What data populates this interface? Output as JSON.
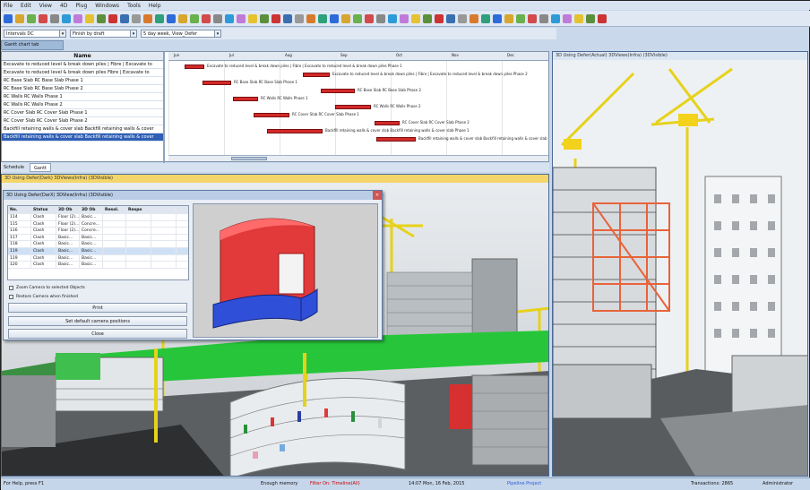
{
  "menu": [
    "File",
    "Edit",
    "View",
    "4D",
    "Plug",
    "Windows",
    "Tools",
    "Help"
  ],
  "toolbar2": {
    "combo1": "Intervals DC",
    "combo2": "Finish by draft",
    "combo3": "5 day week, View_Defer"
  },
  "subtab": "Gantt chart tab",
  "gantt": {
    "header": "Name",
    "rows": [
      "Excavate to reduced level & break down piles | Fibre | Excavate to",
      "Excavate to reduced level & break down piles Fibre | Excavate to",
      "RC Base Slab RC Base Slab Phase 1",
      "RC Base Slab RC Base Slab Phase 2",
      "RC Walls RC Walls Phase 1",
      "RC Walls RC Walls Phase 2",
      "RC Cover Slab RC Cover Slab Phase 1",
      "RC Cover Slab RC Cover Slab Phase 2",
      "Backfill retaining walls & cover slab Backfill retaining walls & cover",
      "Backfill retaining walls & cover slab Backfill retaining walls & cover"
    ],
    "bar_labels": [
      "Excavate to reduced level & break down piles | Fibre | Excavate to reduced level & break down piles Phase 1",
      "Excavate to reduced level & break down piles | Fibre | Excavate to reduced level & break down piles Phase 2",
      "RC Base Slab RC Base Slab Phase 1",
      "RC Base Slab RC Base Slab Phase 2",
      "RC Walls RC Walls Phase 1",
      "RC Walls RC Walls Phase 2",
      "RC Cover Slab RC Cover Slab Phase 1",
      "RC Cover Slab RC Cover Slab Phase 2",
      "Backfill retaining walls & cover slab Backfill retaining walls & cover slab Phase 1",
      "Backfill retaining walls & cover slab Backfill retaining walls & cover slab Phase 2"
    ],
    "scale": [
      "Jun",
      "Jul",
      "Aug",
      "Sep",
      "Oct",
      "Nov",
      "Dec"
    ]
  },
  "lower_tabs": [
    "Schedule",
    "Gantt"
  ],
  "view_main_title": "3D Using Defer(Dark) 3DViews(Infra) (3DVisible)",
  "view_right_title": "3D Using Defer(Actual) 3DViews(Infra) (3DVisible)",
  "dialog": {
    "title": "3D Using Defer(DarX) 3DView(Infra) (3DVisible)",
    "columns": [
      "No.",
      "Status",
      "3D Ob",
      "3D Ob",
      "Resol.",
      "Respo",
      ""
    ],
    "rows": [
      [
        "114",
        "Clash",
        "Floor (2)...",
        "Basic..."
      ],
      [
        "115",
        "Clash",
        "Floor (2)...",
        "Concre..."
      ],
      [
        "116",
        "Clash",
        "Floor (2)...",
        "Concre..."
      ],
      [
        "117",
        "Clash",
        "Basic...",
        "Basic..."
      ],
      [
        "118",
        "Clash",
        "Basic...",
        "Basic..."
      ],
      [
        "119",
        "Clash",
        "Basic...",
        "Basic..."
      ],
      [
        "119",
        "Clash",
        "Basic...",
        "Basic..."
      ],
      [
        "120",
        "Clash",
        "Basic...",
        "Basic..."
      ]
    ],
    "check1": "Zoom Camera to selected Objects",
    "check2": "Restore Camera when finished",
    "btn_print": "Print",
    "btn_default": "Set default camera positions",
    "btn_close": "Close"
  },
  "status": {
    "left": "For Help, press F1",
    "mid1": "Enough memory",
    "mid2": "Filter On: Timeline(All)",
    "date": "14:07 Mon, 16 Feb, 2015",
    "project": "Pipeline Project",
    "transactions": "Transactions: 2865",
    "user": "Administrator"
  },
  "colors": {
    "accent": "#2f5fb5",
    "bar": "#d22a2a",
    "titlebar_main": "#f4d56a",
    "clash_red": "#e23a3a",
    "clash_blue": "#2f4fd8"
  }
}
